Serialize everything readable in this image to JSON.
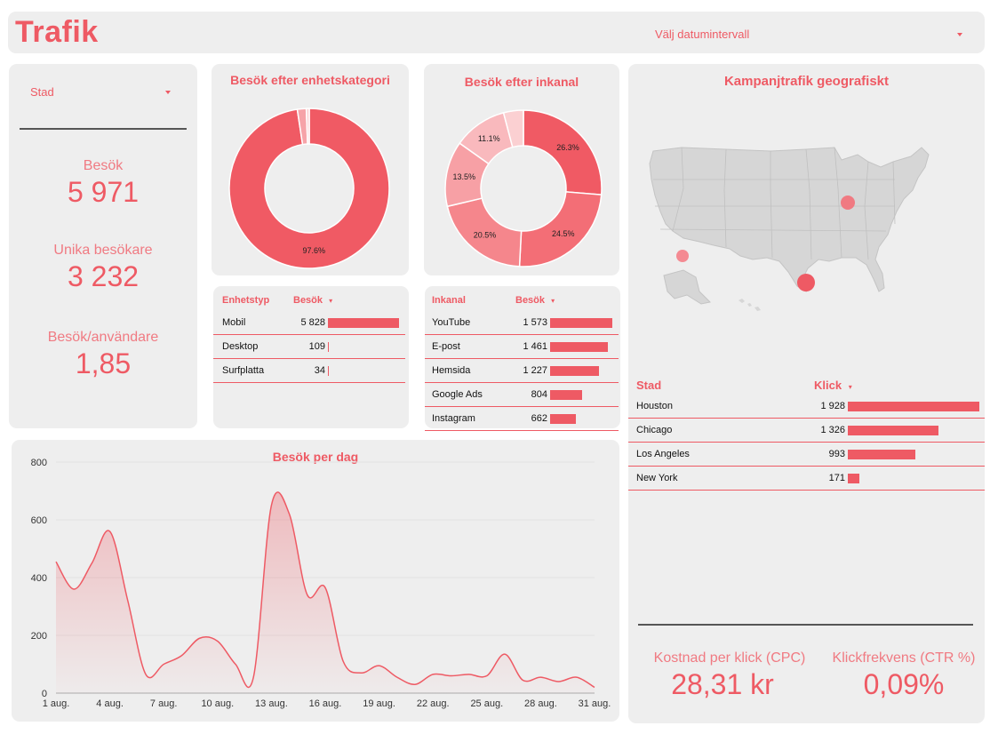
{
  "header": {
    "title": "Trafik",
    "date_picker_label": "Välj datumintervall"
  },
  "filters": {
    "city_label": "Stad"
  },
  "kpis": {
    "visits_label": "Besök",
    "visits_value": "5 971",
    "unique_label": "Unika besökare",
    "unique_value": "3 232",
    "per_user_label": "Besök/användare",
    "per_user_value": "1,85"
  },
  "device_donut": {
    "title": "Besök efter enhetskategori",
    "slices": [
      {
        "label": "97.6%",
        "value": 97.6,
        "color": "#f05a64"
      },
      {
        "label": "",
        "value": 1.8,
        "color": "#f6a3a8"
      },
      {
        "label": "",
        "value": 0.6,
        "color": "#fbd0d2"
      }
    ]
  },
  "channel_donut": {
    "title": "Besök efter inkanal",
    "slices": [
      {
        "label": "26.3%",
        "value": 26.3,
        "color": "#f05a64"
      },
      {
        "label": "24.5%",
        "value": 24.5,
        "color": "#f36e76"
      },
      {
        "label": "20.5%",
        "value": 20.5,
        "color": "#f5868c"
      },
      {
        "label": "13.5%",
        "value": 13.5,
        "color": "#f7a0a5"
      },
      {
        "label": "11.1%",
        "value": 11.1,
        "color": "#f9b9bd"
      },
      {
        "label": "",
        "value": 4.1,
        "color": "#fbd0d2"
      }
    ]
  },
  "device_table": {
    "col1": "Enhetstyp",
    "col2": "Besök",
    "rows": [
      {
        "name": "Mobil",
        "value": "5 828",
        "n": 5828
      },
      {
        "name": "Desktop",
        "value": "109",
        "n": 109
      },
      {
        "name": "Surfplatta",
        "value": "34",
        "n": 34
      }
    ]
  },
  "channel_table": {
    "col1": "Inkanal",
    "col2": "Besök",
    "rows": [
      {
        "name": "YouTube",
        "value": "1 573",
        "n": 1573
      },
      {
        "name": "E-post",
        "value": "1 461",
        "n": 1461
      },
      {
        "name": "Hemsida",
        "value": "1 227",
        "n": 1227
      },
      {
        "name": "Google Ads",
        "value": "804",
        "n": 804
      },
      {
        "name": "Instagram",
        "value": "662",
        "n": 662
      }
    ]
  },
  "geo": {
    "title": "Kampanjtrafik geografiskt",
    "col1": "Stad",
    "col2": "Klick",
    "rows": [
      {
        "name": "Houston",
        "value": "1 928",
        "n": 1928
      },
      {
        "name": "Chicago",
        "value": "1 326",
        "n": 1326
      },
      {
        "name": "Los Angeles",
        "value": "993",
        "n": 993
      },
      {
        "name": "New York",
        "value": "171",
        "n": 171
      }
    ],
    "cpc_label": "Kostnad per klick (CPC)",
    "cpc_value": "28,31 kr",
    "ctr_label": "Klickfrekvens (CTR %)",
    "ctr_value": "0,09%"
  },
  "chart_data": {
    "type": "area",
    "title": "Besök per dag",
    "x": [
      "1 aug.",
      "2 aug.",
      "3 aug.",
      "4 aug.",
      "5 aug.",
      "6 aug.",
      "7 aug.",
      "8 aug.",
      "9 aug.",
      "10 aug.",
      "11 aug.",
      "12 aug.",
      "13 aug.",
      "14 aug.",
      "15 aug.",
      "16 aug.",
      "17 aug.",
      "18 aug.",
      "19 aug.",
      "20 aug.",
      "21 aug.",
      "22 aug.",
      "23 aug.",
      "24 aug.",
      "25 aug.",
      "26 aug.",
      "27 aug.",
      "28 aug.",
      "29 aug.",
      "30 aug.",
      "31 aug."
    ],
    "xticks": [
      "1 aug.",
      "4 aug.",
      "7 aug.",
      "10 aug.",
      "13 aug.",
      "16 aug.",
      "19 aug.",
      "22 aug.",
      "25 aug.",
      "28 aug.",
      "31 aug."
    ],
    "values": [
      455,
      360,
      450,
      560,
      320,
      65,
      100,
      130,
      190,
      180,
      100,
      55,
      650,
      620,
      340,
      365,
      110,
      70,
      95,
      55,
      30,
      65,
      60,
      65,
      60,
      135,
      45,
      55,
      40,
      55,
      20
    ],
    "ylim": [
      0,
      800
    ],
    "yticks": [
      0,
      200,
      400,
      600,
      800
    ],
    "grid": true,
    "color": "#ee5a64"
  }
}
